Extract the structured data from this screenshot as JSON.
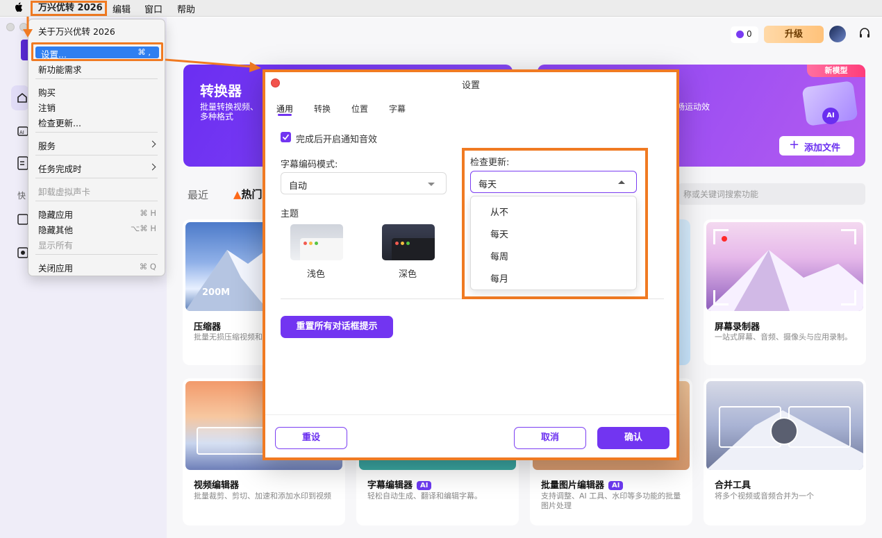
{
  "menubar": {
    "app": "万兴优转 2026",
    "edit": "编辑",
    "window": "窗口",
    "help": "帮助"
  },
  "app_menu": {
    "about": "关于万兴优转 2026",
    "settings": "设置...",
    "settings_shortcut": "⌘ ,",
    "feature_request": "新功能需求",
    "purchase": "购买",
    "logout": "注销",
    "check_update": "检查更新...",
    "services": "服务",
    "on_task_complete": "任务完成时",
    "uninstall_vcard": "卸载虚拟声卡",
    "hide_app": "隐藏应用",
    "hide_app_shortcut": "⌘ H",
    "hide_others": "隐藏其他",
    "hide_others_shortcut": "⌥⌘ H",
    "show_all": "显示所有",
    "quit": "关闭应用",
    "quit_shortcut": "⌘ Q"
  },
  "topbar": {
    "credits": "0",
    "upgrade": "升级"
  },
  "sidebar": {
    "section_fast": "快"
  },
  "banners": {
    "converter_title": "转换器",
    "converter_desc": "批量转换视频、多种格式",
    "right_desc": "畅运动效",
    "new_model_badge": "新模型",
    "add_file": "添加文件"
  },
  "tabs_row": {
    "recent": "最近",
    "hot": "热门",
    "search_placeholder": "称或关键词搜索功能"
  },
  "cards": [
    {
      "title": "压缩器",
      "desc": "批量无损压缩视频和",
      "img_label": "200M",
      "ai": ""
    },
    {
      "title": "屏幕录制器",
      "desc": "一站式屏幕、音频、摄像头与应用录制。",
      "ai": ""
    },
    {
      "title": "视频编辑器",
      "desc": "批量裁剪、剪切、加速和添加水印到视频",
      "ai": ""
    },
    {
      "title": "字幕编辑器",
      "desc": "轻松自动生成、翻译和编辑字幕。",
      "ai": "AI"
    },
    {
      "title": "批量图片编辑器",
      "desc": "支持调整、AI 工具、水印等多功能的批量图片处理",
      "ai": "AI"
    },
    {
      "title": "合并工具",
      "desc": "将多个视频或音频合并为一个",
      "ai": ""
    }
  ],
  "dialog": {
    "title": "设置",
    "tabs": [
      "通用",
      "转换",
      "位置",
      "字幕"
    ],
    "notify_label": "完成后开启通知音效",
    "notify_checked": true,
    "subtitle_encoding_label": "字幕编码模式:",
    "subtitle_encoding_value": "自动",
    "theme_label": "主题",
    "theme_light": "浅色",
    "theme_dark": "深色",
    "check_update_label": "检查更新:",
    "check_update_value": "每天",
    "check_update_options": [
      "从不",
      "每天",
      "每周",
      "每月"
    ],
    "reset_prompts": "重置所有对话框提示",
    "reset": "重设",
    "cancel": "取消",
    "confirm": "确认"
  },
  "colors": {
    "accent": "#7235f1",
    "highlight": "#f07a22",
    "menu_selection": "#2f7ff0"
  }
}
